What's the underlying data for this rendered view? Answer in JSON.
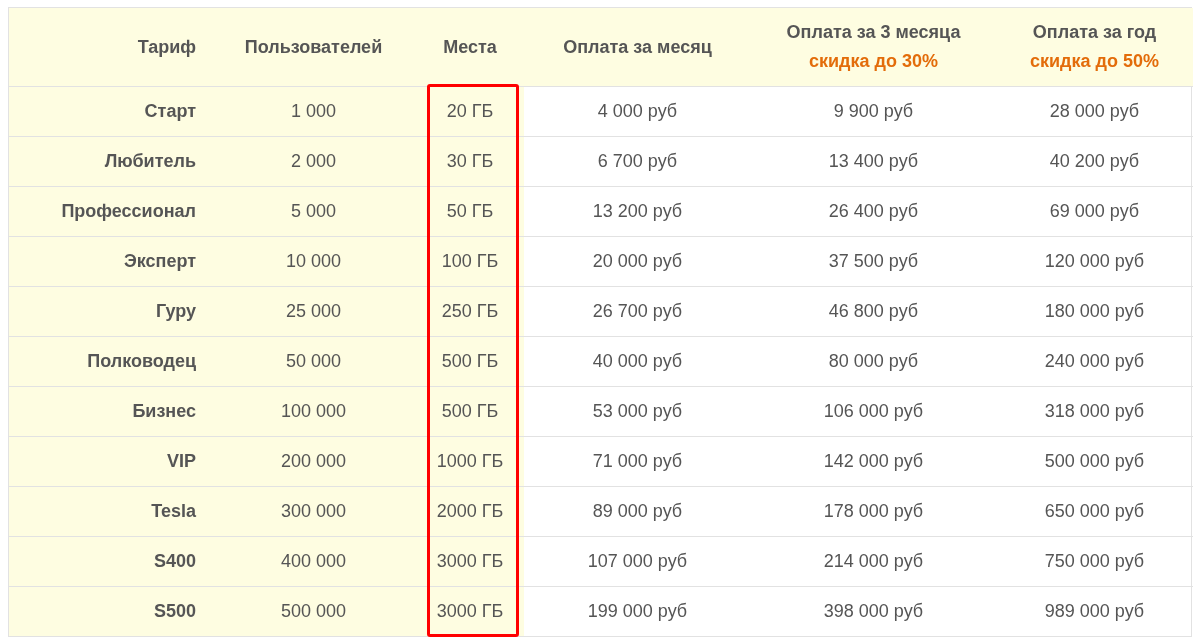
{
  "table": {
    "columns": [
      {
        "label": "Тариф",
        "highlighted": false
      },
      {
        "label": "Пользователей",
        "highlighted": false
      },
      {
        "label": "Места",
        "highlighted": true
      },
      {
        "label": "Оплата за месяц",
        "highlighted": false
      },
      {
        "label": "Оплата за 3 месяца",
        "discount": "скидка до 30%",
        "highlighted": false
      },
      {
        "label": "Оплата за год",
        "discount": "скидка до 50%",
        "highlighted": false
      }
    ],
    "rows": [
      [
        "Старт",
        "1 000",
        "20 ГБ",
        "4 000 руб",
        "9 900 руб",
        "28 000 руб"
      ],
      [
        "Любитель",
        "2 000",
        "30 ГБ",
        "6 700 руб",
        "13 400 руб",
        "40 200 руб"
      ],
      [
        "Профессионал",
        "5 000",
        "50 ГБ",
        "13 200 руб",
        "26 400 руб",
        "69 000 руб"
      ],
      [
        "Эксперт",
        "10 000",
        "100 ГБ",
        "20 000 руб",
        "37 500 руб",
        "120 000 руб"
      ],
      [
        "Гуру",
        "25 000",
        "250 ГБ",
        "26 700 руб",
        "46 800 руб",
        "180 000 руб"
      ],
      [
        "Полководец",
        "50 000",
        "500 ГБ",
        "40 000 руб",
        "80 000 руб",
        "240 000 руб"
      ],
      [
        "Бизнес",
        "100 000",
        "500 ГБ",
        "53 000 руб",
        "106 000 руб",
        "318 000 руб"
      ],
      [
        "VIP",
        "200 000",
        "1000 ГБ",
        "71 000 руб",
        "142 000 руб",
        "500 000 руб"
      ],
      [
        "Tesla",
        "300 000",
        "2000 ГБ",
        "89 000 руб",
        "178 000 руб",
        "650 000 руб"
      ],
      [
        "S400",
        "400 000",
        "3000 ГБ",
        "107 000 руб",
        "214 000 руб",
        "750 000 руб"
      ],
      [
        "S500",
        "500 000",
        "3000 ГБ",
        "199 000 руб",
        "398 000 руб",
        "989 000 руб"
      ]
    ]
  }
}
